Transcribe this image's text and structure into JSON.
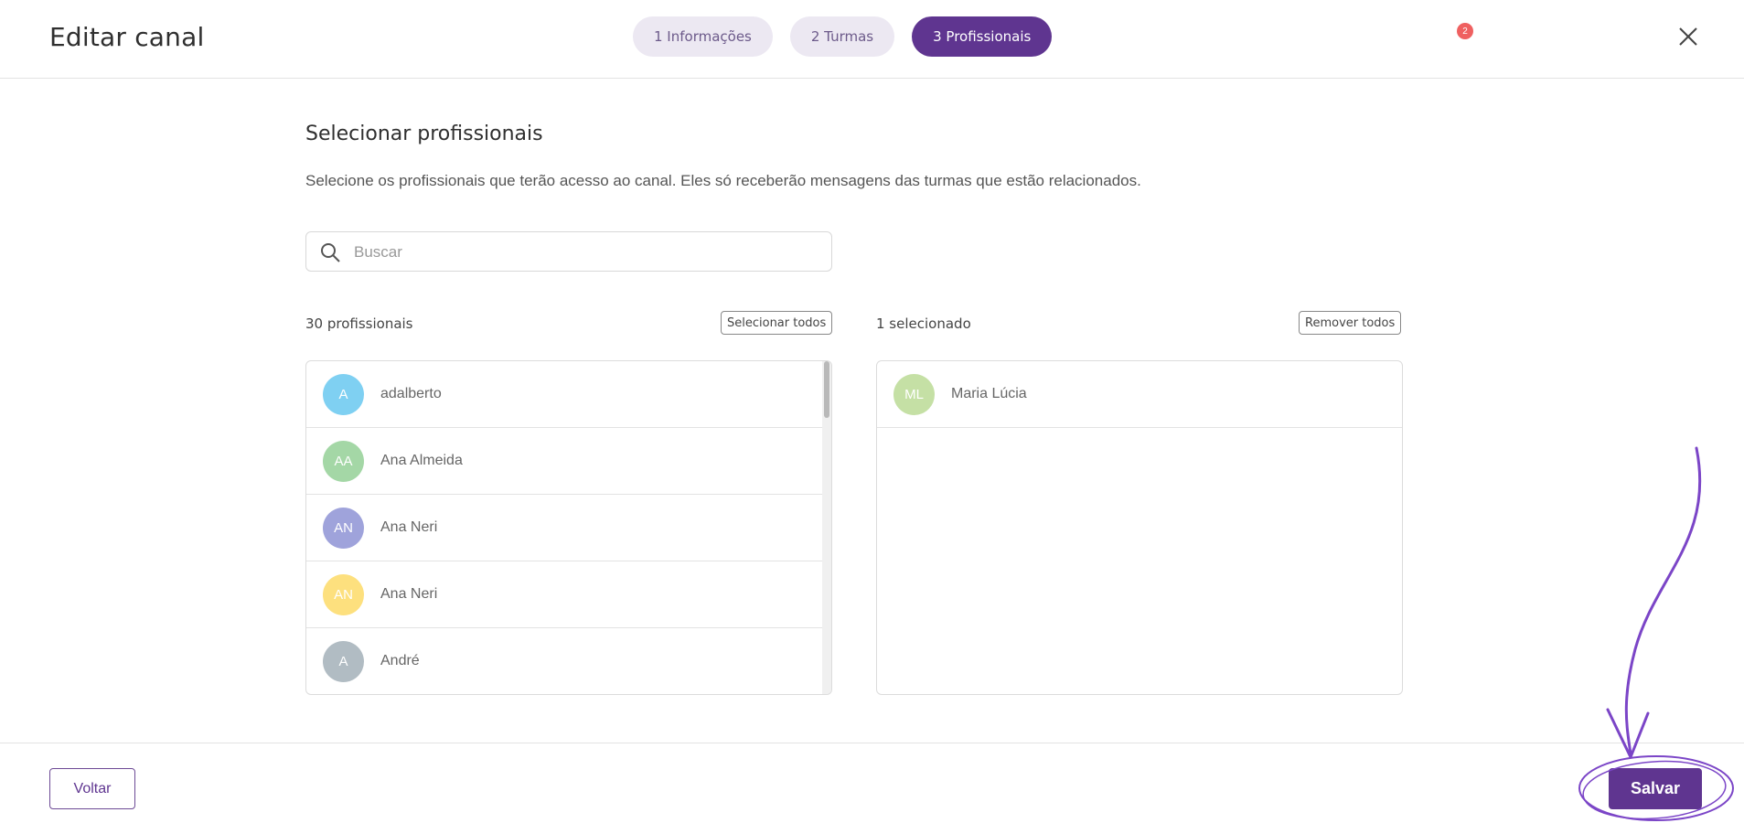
{
  "header": {
    "title": "Editar canal",
    "steps": [
      {
        "label": "1 Informações",
        "active": false
      },
      {
        "label": "2 Turmas",
        "active": false
      },
      {
        "label": "3 Profissionais",
        "active": true
      }
    ],
    "notification_count": "2",
    "close_icon": "close-icon"
  },
  "main": {
    "section_title": "Selecionar profissionais",
    "description": "Selecione os profissionais que terão acesso ao canal. Eles só receberão mensagens das turmas que estão relacionados.",
    "search": {
      "placeholder": "Buscar",
      "value": "",
      "icon": "search-icon"
    },
    "available": {
      "count_label": "30 profissionais",
      "select_all_label": "Selecionar todos",
      "items": [
        {
          "initials": "A",
          "name": "adalberto",
          "color": "#7fd0f2"
        },
        {
          "initials": "AA",
          "name": "Ana Almeida",
          "color": "#a4d7a6"
        },
        {
          "initials": "AN",
          "name": "Ana Neri",
          "color": "#9fa3db"
        },
        {
          "initials": "AN",
          "name": "Ana Neri",
          "color": "#fde07e"
        },
        {
          "initials": "A",
          "name": "André",
          "color": "#b1bcc3"
        }
      ]
    },
    "selected": {
      "count_label": "1 selecionado",
      "remove_all_label": "Remover todos",
      "items": [
        {
          "initials": "ML",
          "name": "Maria Lúcia",
          "color": "#c5e0a5"
        }
      ]
    }
  },
  "footer": {
    "back_label": "Voltar",
    "save_label": "Salvar"
  },
  "colors": {
    "brand": "#5f3590",
    "step_inactive_bg": "#ece8f2",
    "badge": "#ef6060",
    "annotation": "#7b45c7"
  }
}
